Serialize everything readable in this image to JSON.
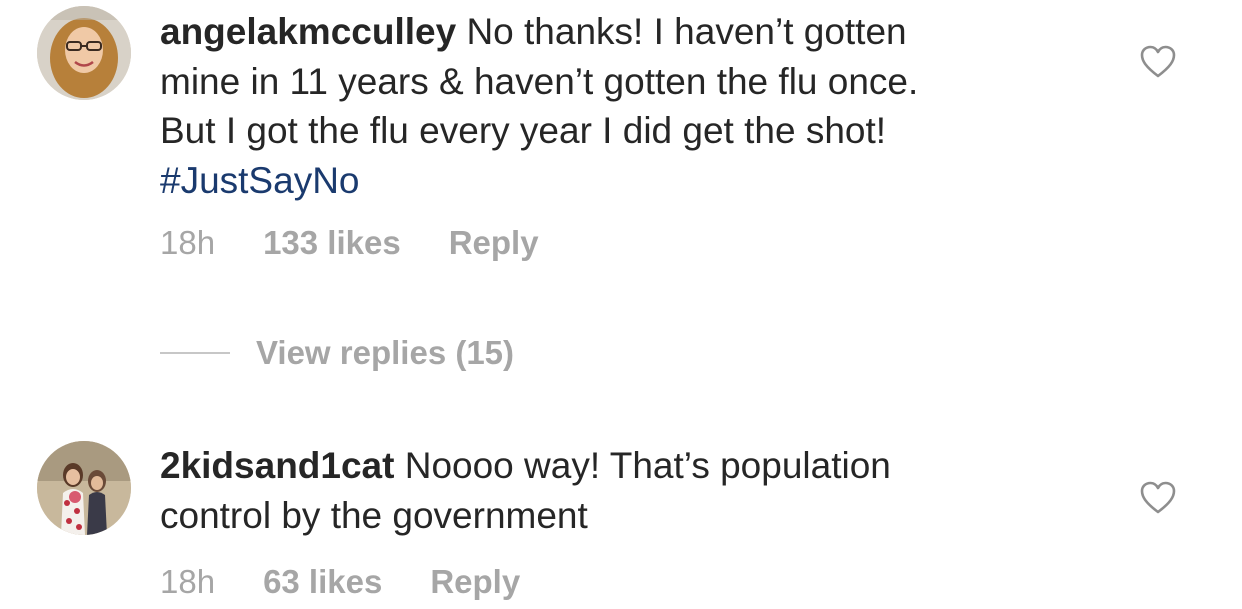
{
  "comments": [
    {
      "username": "angelakmcculley",
      "text_lines": [
        " No thanks! I haven’t gotten",
        "mine in 11 years & haven’t gotten the flu once.",
        "But I got the flu every year I did get the shot!"
      ],
      "hashtag": "#JustSayNo",
      "time": "18h",
      "likes": "133 likes",
      "reply_label": "Reply",
      "view_replies_label": "View replies (15)",
      "like_icon": "heart-outline-icon"
    },
    {
      "username": "2kidsand1cat",
      "text_lines": [
        " Noooo way!  That’s population",
        "control by the government"
      ],
      "time": "18h",
      "likes": "63 likes",
      "reply_label": "Reply",
      "like_icon": "heart-outline-icon"
    }
  ],
  "colors": {
    "text": "#262626",
    "secondary": "#a6a6a6",
    "hashtag": "#1a3a6e"
  }
}
